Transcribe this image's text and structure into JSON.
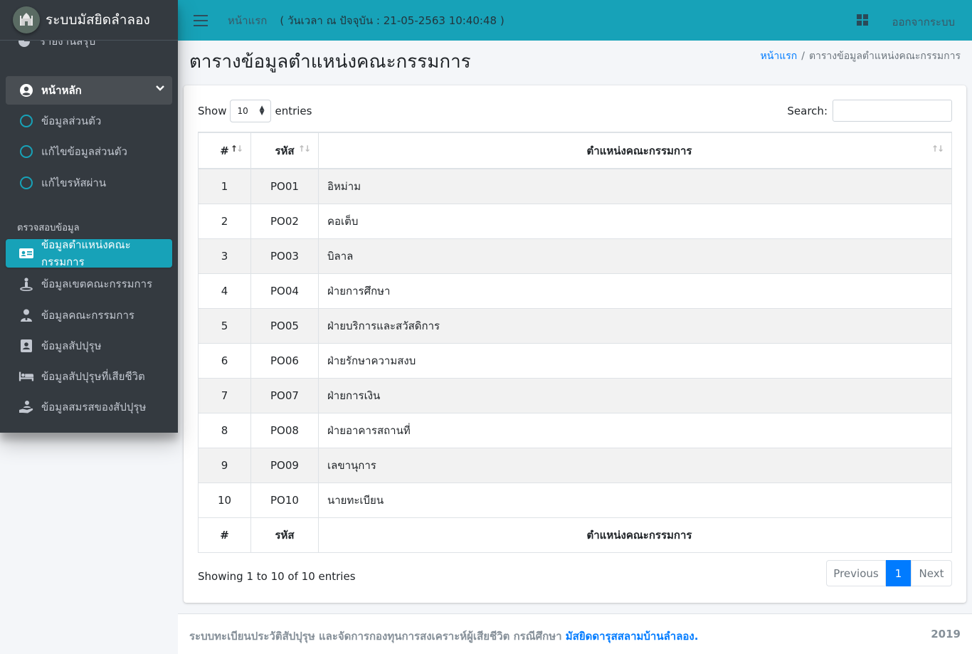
{
  "sidebar": {
    "brand": "ระบบมัสยิดลำลอง",
    "partial_item": "รายงานสรุป",
    "main_item": "หน้าหลัก",
    "sub_items": [
      "ข้อมูลส่วนตัว",
      "แก้ไขข้อมูลส่วนตัว",
      "แก้ไขรหัสผ่าน"
    ],
    "section_header": "ตรวจสอบข้อมูล",
    "data_items": [
      {
        "label": "ข้อมูลตำแหน่งคณะกรรมการ",
        "icon": "id-card-icon",
        "active": true
      },
      {
        "label": "ข้อมูลเขตคณะกรรมการ",
        "icon": "person-map-icon",
        "active": false
      },
      {
        "label": "ข้อมูลคณะกรรมการ",
        "icon": "user-tie-icon",
        "active": false
      },
      {
        "label": "ข้อมูลสัปปุรุษ",
        "icon": "address-book-icon",
        "active": false
      },
      {
        "label": "ข้อมูลสัปปุรุษที่เสียชีวิต",
        "icon": "bed-icon",
        "active": false
      },
      {
        "label": "ข้อมูลสมรสของสัปปุรุษ",
        "icon": "hand-holding-user-icon",
        "active": false
      }
    ]
  },
  "topbar": {
    "home": "หน้าแรก",
    "datetime": "( วันเวลา ณ ปัจจุบัน : 21-05-2563 10:40:48 )",
    "logout": "ออกจากระบบ"
  },
  "page": {
    "title": "ตารางข้อมูลตำแหน่งคณะกรรมการ",
    "breadcrumb_home": "หน้าแรก",
    "breadcrumb_sep": "/",
    "breadcrumb_current": "ตารางข้อมูลตำแหน่งคณะกรรมการ"
  },
  "table": {
    "show_label": "Show",
    "entries_value": "10",
    "entries_label": "entries",
    "search_label": "Search:",
    "columns": [
      "#",
      "รหัส",
      "ตำแหน่งคณะกรรมการ"
    ],
    "rows": [
      [
        "1",
        "PO01",
        "อิหม่าม"
      ],
      [
        "2",
        "PO02",
        "คอเต็บ"
      ],
      [
        "3",
        "PO03",
        "บิลาล"
      ],
      [
        "4",
        "PO04",
        "ฝ่ายการศึกษา"
      ],
      [
        "5",
        "PO05",
        "ฝ่ายบริการและสวัสดิการ"
      ],
      [
        "6",
        "PO06",
        "ฝ่ายรักษาความสงบ"
      ],
      [
        "7",
        "PO07",
        "ฝ่ายการเงิน"
      ],
      [
        "8",
        "PO08",
        "ฝ่ายอาคารสถานที่"
      ],
      [
        "9",
        "PO09",
        "เลขานุการ"
      ],
      [
        "10",
        "PO10",
        "นายทะเบียน"
      ]
    ],
    "info": "Showing 1 to 10 of 10 entries",
    "pagination": {
      "previous": "Previous",
      "current": "1",
      "next": "Next"
    }
  },
  "footer": {
    "text": "ระบบทะเบียนประวัติสัปปุรุษ และจัดการกองทุนการสงเคราะห์ผู้เสียชีวิต กรณีศึกษา",
    "link": "มัสยิดดารุสสลามบ้านลำลอง.",
    "year": "2019"
  },
  "colors": {
    "sidebar": "#343a40",
    "topbar": "#17a2b8",
    "active": "#17a2b8",
    "link": "#007bff"
  }
}
